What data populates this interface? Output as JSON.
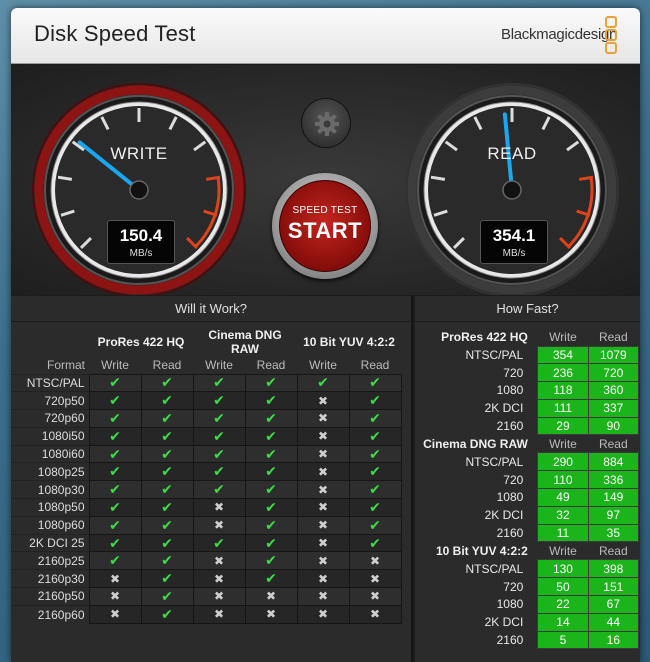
{
  "window": {
    "title": "Disk Speed Test",
    "brand": "Blackmagicdesign",
    "accent": "#e8a23a"
  },
  "gauges": {
    "write": {
      "label": "WRITE",
      "value": "150.4",
      "unit": "MB/s",
      "needle_fraction": 0.31
    },
    "read": {
      "label": "READ",
      "value": "354.1",
      "unit": "MB/s",
      "needle_fraction": 0.48
    }
  },
  "start_button": {
    "line1": "SPEED TEST",
    "line2": "START"
  },
  "settings_button": {
    "icon": "gear-icon"
  },
  "will_it_work": {
    "title": "Will it Work?",
    "format_header": "Format",
    "groups": [
      "ProRes 422 HQ",
      "Cinema DNG RAW",
      "10 Bit YUV 4:2:2"
    ],
    "subheaders": [
      "Write",
      "Read",
      "Write",
      "Read",
      "Write",
      "Read"
    ],
    "rows": [
      {
        "format": "NTSC/PAL",
        "cells": [
          1,
          1,
          1,
          1,
          1,
          1
        ]
      },
      {
        "format": "720p50",
        "cells": [
          1,
          1,
          1,
          1,
          0,
          1
        ]
      },
      {
        "format": "720p60",
        "cells": [
          1,
          1,
          1,
          1,
          0,
          1
        ]
      },
      {
        "format": "1080i50",
        "cells": [
          1,
          1,
          1,
          1,
          0,
          1
        ]
      },
      {
        "format": "1080i60",
        "cells": [
          1,
          1,
          1,
          1,
          0,
          1
        ]
      },
      {
        "format": "1080p25",
        "cells": [
          1,
          1,
          1,
          1,
          0,
          1
        ]
      },
      {
        "format": "1080p30",
        "cells": [
          1,
          1,
          1,
          1,
          0,
          1
        ]
      },
      {
        "format": "1080p50",
        "cells": [
          1,
          1,
          0,
          1,
          0,
          1
        ]
      },
      {
        "format": "1080p60",
        "cells": [
          1,
          1,
          0,
          1,
          0,
          1
        ]
      },
      {
        "format": "2K DCI 25",
        "cells": [
          1,
          1,
          1,
          1,
          0,
          1
        ]
      },
      {
        "format": "2160p25",
        "cells": [
          1,
          1,
          0,
          1,
          0,
          0
        ]
      },
      {
        "format": "2160p30",
        "cells": [
          0,
          1,
          0,
          1,
          0,
          0
        ]
      },
      {
        "format": "2160p50",
        "cells": [
          0,
          1,
          0,
          0,
          0,
          0
        ]
      },
      {
        "format": "2160p60",
        "cells": [
          0,
          1,
          0,
          0,
          0,
          0
        ]
      }
    ]
  },
  "how_fast": {
    "title": "How Fast?",
    "col_write": "Write",
    "col_read": "Read",
    "groups": [
      {
        "name": "ProRes 422 HQ",
        "rows": [
          {
            "label": "NTSC/PAL",
            "write": "354",
            "read": "1079"
          },
          {
            "label": "720",
            "write": "236",
            "read": "720"
          },
          {
            "label": "1080",
            "write": "118",
            "read": "360"
          },
          {
            "label": "2K DCI",
            "write": "111",
            "read": "337"
          },
          {
            "label": "2160",
            "write": "29",
            "read": "90"
          }
        ]
      },
      {
        "name": "Cinema DNG RAW",
        "rows": [
          {
            "label": "NTSC/PAL",
            "write": "290",
            "read": "884"
          },
          {
            "label": "720",
            "write": "110",
            "read": "336"
          },
          {
            "label": "1080",
            "write": "49",
            "read": "149"
          },
          {
            "label": "2K DCI",
            "write": "32",
            "read": "97"
          },
          {
            "label": "2160",
            "write": "11",
            "read": "35"
          }
        ]
      },
      {
        "name": "10 Bit YUV 4:2:2",
        "rows": [
          {
            "label": "NTSC/PAL",
            "write": "130",
            "read": "398"
          },
          {
            "label": "720",
            "write": "50",
            "read": "151"
          },
          {
            "label": "1080",
            "write": "22",
            "read": "67"
          },
          {
            "label": "2K DCI",
            "write": "14",
            "read": "44"
          },
          {
            "label": "2160",
            "write": "5",
            "read": "16"
          }
        ]
      }
    ]
  }
}
